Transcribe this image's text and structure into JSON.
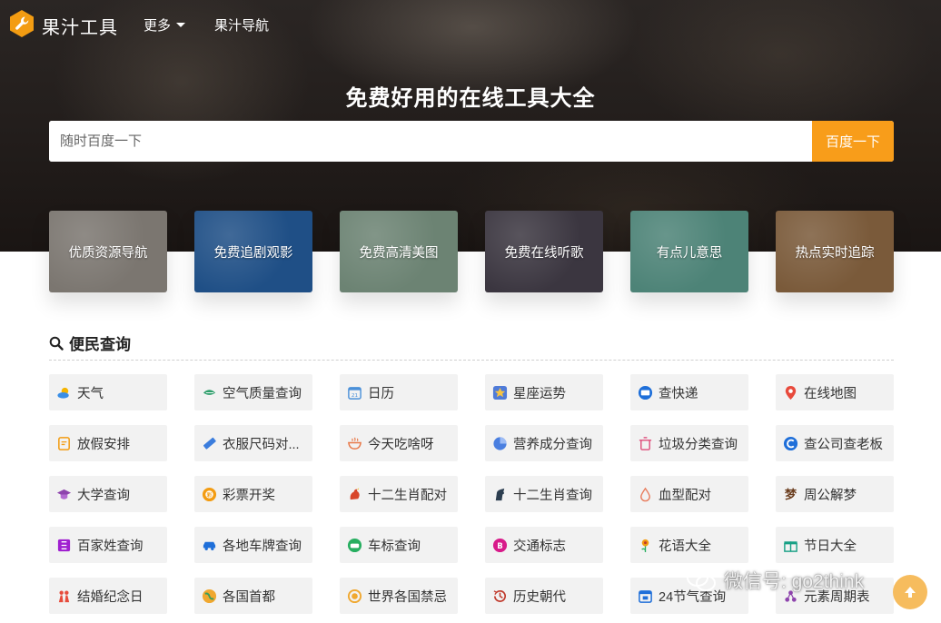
{
  "nav": {
    "logo": "果汁工具",
    "more": "更多",
    "link": "果汁导航"
  },
  "hero": {
    "title": "免费好用的在线工具大全",
    "search_placeholder": "随时百度一下",
    "search_button": "百度一下"
  },
  "cards": [
    {
      "label": "优质资源导航",
      "bg": "#7b7670"
    },
    {
      "label": "免费追剧观影",
      "bg": "#1f4f86"
    },
    {
      "label": "免费高清美图",
      "bg": "#6c8373"
    },
    {
      "label": "免费在线听歌",
      "bg": "#3b3640"
    },
    {
      "label": "有点儿意思",
      "bg": "#4d8377"
    },
    {
      "label": "热点实时追踪",
      "bg": "#7a5a3a"
    }
  ],
  "section": {
    "title": "便民查询"
  },
  "tools": [
    {
      "label": "天气",
      "icon": "weather-icon"
    },
    {
      "label": "空气质量查询",
      "icon": "air-quality-icon"
    },
    {
      "label": "日历",
      "icon": "calendar-icon"
    },
    {
      "label": "星座运势",
      "icon": "star-icon"
    },
    {
      "label": "查快递",
      "icon": "express-icon"
    },
    {
      "label": "在线地图",
      "icon": "map-pin-icon"
    },
    {
      "label": "放假安排",
      "icon": "holiday-note-icon"
    },
    {
      "label": "衣服尺码对...",
      "icon": "ruler-icon"
    },
    {
      "label": "今天吃啥呀",
      "icon": "bowl-icon"
    },
    {
      "label": "营养成分查询",
      "icon": "pie-icon"
    },
    {
      "label": "垃圾分类查询",
      "icon": "trash-icon"
    },
    {
      "label": "查公司查老板",
      "icon": "company-icon"
    },
    {
      "label": "大学查询",
      "icon": "graduation-cap-icon"
    },
    {
      "label": "彩票开奖",
      "icon": "lottery-icon"
    },
    {
      "label": "十二生肖配对",
      "icon": "rooster-icon"
    },
    {
      "label": "十二生肖查询",
      "icon": "horse-icon"
    },
    {
      "label": "血型配对",
      "icon": "blood-drop-icon"
    },
    {
      "label": "周公解梦",
      "icon": "dream-icon"
    },
    {
      "label": "百家姓查询",
      "icon": "surname-book-icon"
    },
    {
      "label": "各地车牌查询",
      "icon": "car-icon"
    },
    {
      "label": "车标查询",
      "icon": "car-logo-icon"
    },
    {
      "label": "交通标志",
      "icon": "traffic-sign-icon"
    },
    {
      "label": "花语大全",
      "icon": "flower-icon"
    },
    {
      "label": "节日大全",
      "icon": "gift-icon"
    },
    {
      "label": "结婚纪念日",
      "icon": "wedding-icon"
    },
    {
      "label": "各国首都",
      "icon": "globe-icon"
    },
    {
      "label": "世界各国禁忌",
      "icon": "ban-icon"
    },
    {
      "label": "历史朝代",
      "icon": "history-icon"
    },
    {
      "label": "24节气查询",
      "icon": "solar-term-icon"
    },
    {
      "label": "元素周期表",
      "icon": "molecule-icon"
    }
  ],
  "watermark": "微信号: go2think"
}
